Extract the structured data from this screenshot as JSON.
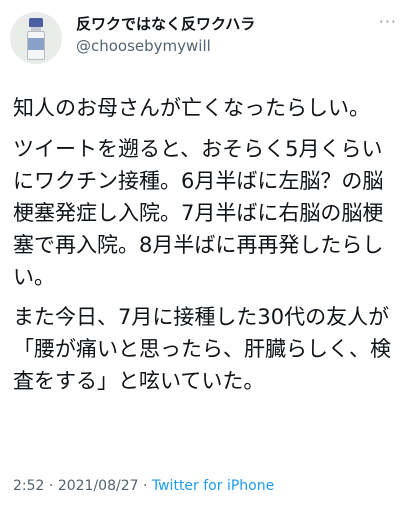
{
  "user": {
    "display_name": "反ワクではなく反ワクハラ",
    "handle": "@choosebymywill",
    "avatar_icon": "vaccine-vial-icon"
  },
  "more_menu": "···",
  "tweet": {
    "paragraphs": [
      "知人のお母さんが亡くなったらしい。",
      "ツイートを遡ると、おそらく5月くらいにワクチン接種。6月半ばに左脳？の脳梗塞発症し入院。7月半ばに右脳の脳梗塞で再入院。8月半ばに再再発したらしい。",
      "また今日、7月に接種した30代の友人が「腰が痛いと思ったら、肝臓らしく、検査をする」と呟いていた。"
    ]
  },
  "meta": {
    "time": "2:52",
    "separator1": " · ",
    "date": "2021/08/27",
    "separator2": " · ",
    "source": "Twitter for iPhone"
  },
  "colors": {
    "text": "#0f1419",
    "secondary": "#536471",
    "link": "#1d9bf0"
  }
}
